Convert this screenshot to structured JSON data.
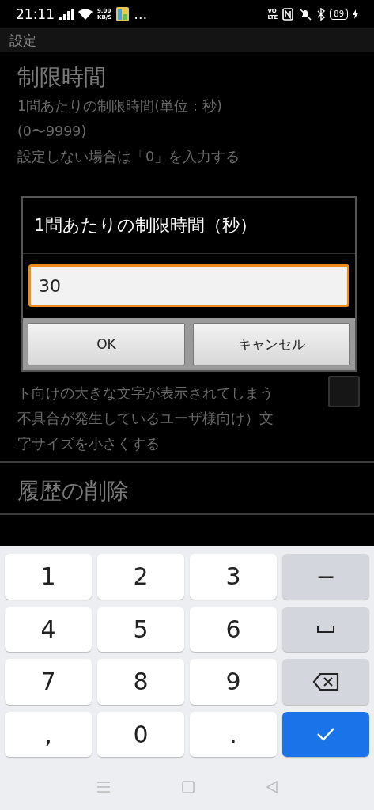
{
  "status_bar": {
    "time": "21:11",
    "speed_value": "9.00",
    "speed_unit": "KB/S",
    "more": "…",
    "volte_top": "VO",
    "volte_bottom": "LTE",
    "battery": "89"
  },
  "app_bar": {
    "title": "設定"
  },
  "settings": [
    {
      "kind": "text",
      "title": "制限時間",
      "description": [
        "1問あたりの制限時間(単位：秒)",
        "(0〜9999)",
        "設定しない場合は「0」を入力する"
      ]
    },
    {
      "kind": "check",
      "checked": false,
      "description": [
        "ト向けの大きな文字が表示されてしまう",
        "不具合が発生しているユーザ様向け）文",
        "字サイズを小さくする"
      ]
    },
    {
      "kind": "text",
      "title": "履歴の削除"
    }
  ],
  "dialog": {
    "title": "1問あたりの制限時間（秒）",
    "value": "30",
    "buttons": [
      "OK",
      "キャンセル"
    ]
  },
  "keyboard": {
    "keys": [
      {
        "kind": "char",
        "label": "1"
      },
      {
        "kind": "char",
        "label": "2"
      },
      {
        "kind": "char",
        "label": "3"
      },
      {
        "kind": "func",
        "label": "−"
      },
      {
        "kind": "char",
        "label": "4"
      },
      {
        "kind": "char",
        "label": "5"
      },
      {
        "kind": "char",
        "label": "6"
      },
      {
        "kind": "space"
      },
      {
        "kind": "char",
        "label": "7"
      },
      {
        "kind": "char",
        "label": "8"
      },
      {
        "kind": "char",
        "label": "9"
      },
      {
        "kind": "backspace"
      },
      {
        "kind": "char",
        "label": ","
      },
      {
        "kind": "char",
        "label": "0"
      },
      {
        "kind": "char",
        "label": "."
      },
      {
        "kind": "enter"
      }
    ]
  }
}
